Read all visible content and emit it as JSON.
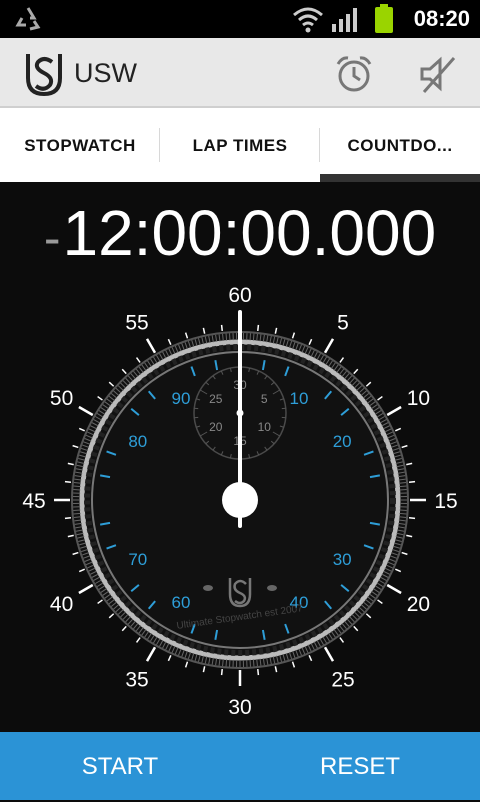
{
  "status": {
    "time": "08:20",
    "icons": [
      "recycle-icon",
      "wifi-icon",
      "signal-icon",
      "battery-icon"
    ]
  },
  "app": {
    "title": "USW",
    "logo": "usw-logo",
    "actions": [
      "alarm-clock-icon",
      "mute-icon"
    ]
  },
  "tabs": [
    {
      "label": "STOPWATCH",
      "active": false
    },
    {
      "label": "LAP TIMES",
      "active": false
    },
    {
      "label": "COUNTDO...",
      "active": true
    }
  ],
  "timer": {
    "sign": "-",
    "value": "12:00:00.000"
  },
  "dial": {
    "outer_labels": [
      "60",
      "5",
      "10",
      "15",
      "20",
      "25",
      "30",
      "35",
      "40",
      "45",
      "50",
      "55"
    ],
    "inner_labels": [
      "90",
      "10",
      "20",
      "30",
      "40",
      "60",
      "70",
      "80"
    ],
    "sub_labels": [
      "30",
      "5",
      "10",
      "15",
      "20",
      "25"
    ],
    "engraving": "Ultimate Stopwatch est 2007",
    "accent": "#2e9ed8",
    "hand_seconds": 0
  },
  "buttons": {
    "start": "START",
    "reset": "RESET"
  },
  "colors": {
    "bottom_bar": "#2b93d6",
    "app_bar": "#e8e8e8"
  }
}
